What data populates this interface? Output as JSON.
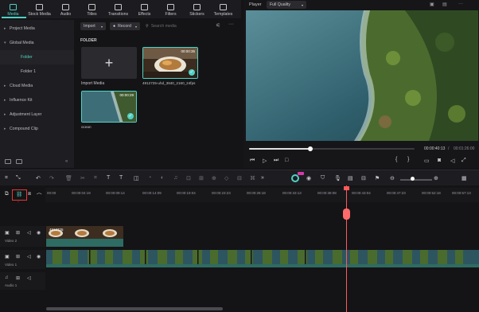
{
  "tabs": [
    {
      "label": "Media",
      "icon": "media-icon",
      "active": true
    },
    {
      "label": "Stock Media",
      "icon": "stock-media-icon"
    },
    {
      "label": "Audio",
      "icon": "audio-icon"
    },
    {
      "label": "Titles",
      "icon": "titles-icon"
    },
    {
      "label": "Transitions",
      "icon": "transitions-icon"
    },
    {
      "label": "Effects",
      "icon": "effects-icon"
    },
    {
      "label": "Filters",
      "icon": "filters-icon"
    },
    {
      "label": "Stickers",
      "icon": "stickers-icon"
    },
    {
      "label": "Templates",
      "icon": "templates-icon"
    }
  ],
  "nav": [
    {
      "label": "Project Media",
      "arrow": "▸"
    },
    {
      "label": "Global Media",
      "arrow": "▾"
    },
    {
      "label": "Folder",
      "sub": true,
      "selected": true
    },
    {
      "label": "Folder 1",
      "sub": true
    },
    {
      "label": "Cloud Media",
      "arrow": "▸"
    },
    {
      "label": "Influence Kit",
      "arrow": "▸"
    },
    {
      "label": "Adjustment Layer",
      "arrow": "▸"
    },
    {
      "label": "Compound Clip",
      "arrow": "▸"
    }
  ],
  "media": {
    "import_label": "Import",
    "record_label": "Record",
    "search_placeholder": "Search media",
    "folder_label": "FOLDER",
    "import_media_label": "Import Media",
    "clip1_name": "4912725-uhd_3840_2160_24fps",
    "clip1_duration": "00:00:35",
    "clip2_name": "ocean",
    "clip2_duration": "00:00:29"
  },
  "player": {
    "label": "Player",
    "quality": "Full Quality",
    "current_time": "00:00:40:13",
    "total_time": "00:01:26:00",
    "progress": 0.37
  },
  "ruler": {
    "ticks": [
      "00:00",
      "00:00:04:19",
      "00:00:09:14",
      "00:00:14:09",
      "00:00:19:04",
      "00:00:23:23",
      "00:00:28:18",
      "00:00:33:13",
      "00:00:38:08",
      "00:00:43:04",
      "00:00:47:23",
      "00:00:52:18",
      "00:00:57:13"
    ]
  },
  "tracks": {
    "video2": "Video 2",
    "video1": "Video 1",
    "audio1": "Audio 1",
    "clip_title": "4912725"
  },
  "colors": {
    "accent": "#4fd1c5",
    "playhead": "#ff5a5a",
    "annotation": "#e53935"
  }
}
